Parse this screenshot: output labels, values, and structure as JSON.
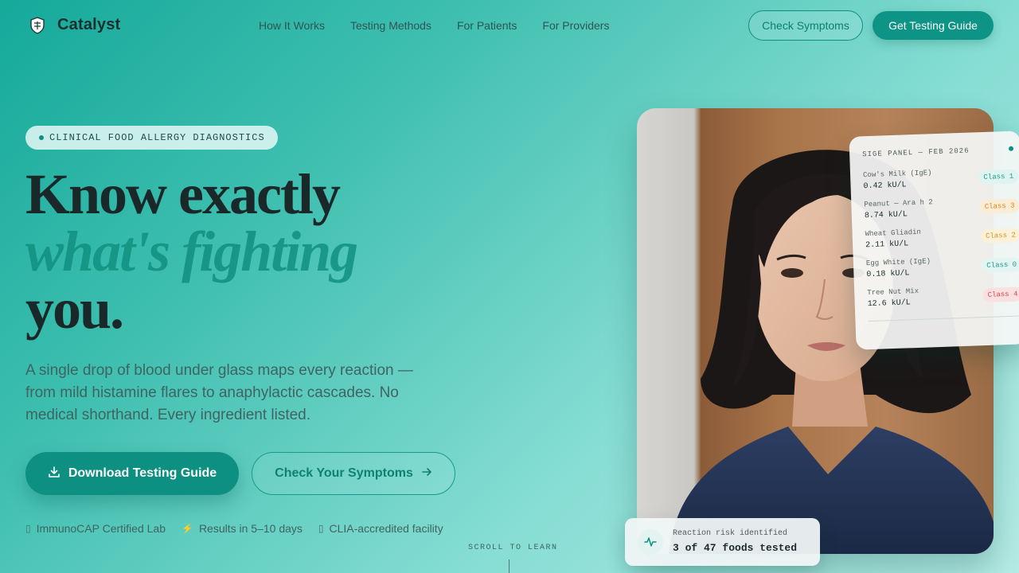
{
  "brand": {
    "name": "Catalyst",
    "logo_icon": "shield-crest-icon"
  },
  "nav": {
    "links": [
      "How It Works",
      "Testing Methods",
      "For Patients",
      "For Providers"
    ],
    "check_symptoms": "Check Symptoms",
    "get_guide": "Get Testing Guide"
  },
  "hero": {
    "eyebrow": "CLINICAL FOOD ALLERGY DIAGNOSTICS",
    "headline_line1": "Know exactly",
    "headline_line2": "what's fighting",
    "headline_line3": "you.",
    "subtext": "A single drop of blood under glass maps every reaction — from mild histamine flares to anaphylactic cascades. No medical shorthand. Every ingredient listed.",
    "primary_cta": "Download Testing Guide",
    "secondary_cta": "Check Your Symptoms",
    "trust": [
      {
        "icon": "lab-icon",
        "label": "ImmunoCAP Certified Lab"
      },
      {
        "icon": "lightning-icon",
        "label": "Results in 5–10 days"
      },
      {
        "icon": "shield-icon",
        "label": "CLIA-accredited facility"
      }
    ],
    "scroll_cue": "SCROLL TO LEARN"
  },
  "lab_panel": {
    "title": "SIGE PANEL — FEB 2026",
    "rows": [
      {
        "name": "Cow's Milk (IgE)",
        "value": "0.42 kU/L",
        "class": "Class 1",
        "color": "#1e9a8c",
        "bg": "#dff4f1"
      },
      {
        "name": "Peanut — Ara h 2",
        "value": "8.74 kU/L",
        "class": "Class 3",
        "color": "#d98a1a",
        "bg": "#fbecd6"
      },
      {
        "name": "Wheat Gliadin",
        "value": "2.11 kU/L",
        "class": "Class 2",
        "color": "#d39420",
        "bg": "#fbf0d8"
      },
      {
        "name": "Egg White (IgE)",
        "value": "0.18 kU/L",
        "class": "Class 0",
        "color": "#1e9a8c",
        "bg": "#e3f5f2"
      },
      {
        "name": "Tree Nut Mix",
        "value": "12.6 kU/L",
        "class": "Class 4",
        "color": "#d8434f",
        "bg": "#fbe0e2"
      }
    ]
  },
  "risk_card": {
    "label": "Reaction risk identified",
    "value": "3 of 47 foods tested",
    "icon": "pulse-icon"
  },
  "colors": {
    "accent": "#0d9486",
    "dark": "#1b2829"
  }
}
